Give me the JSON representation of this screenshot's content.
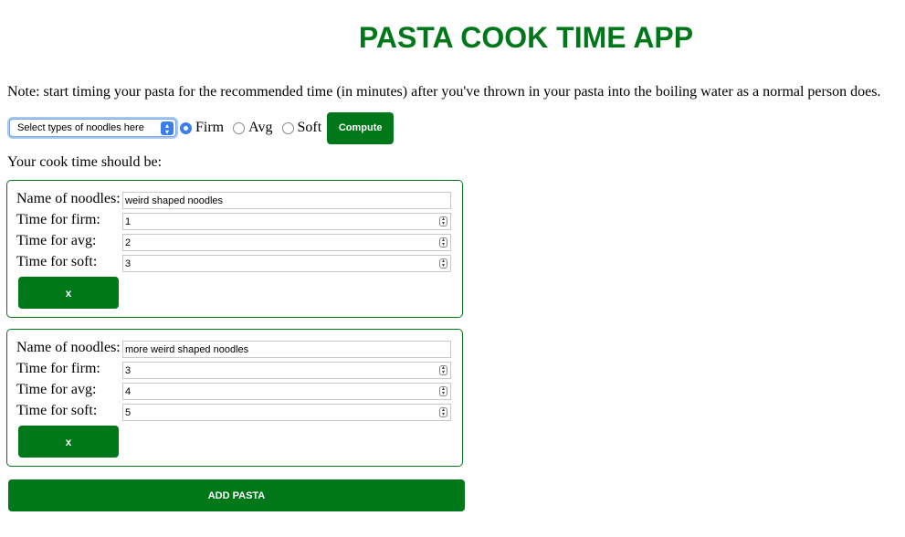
{
  "header": {
    "title": "PASTA COOK TIME APP"
  },
  "note": "Note: start timing your pasta for the recommended time (in minutes) after you've thrown in your pasta into the boiling water as a normal person does.",
  "controls": {
    "select_value": "Select types of noodles here",
    "options": [
      {
        "label": "Firm",
        "selected": true
      },
      {
        "label": "Avg",
        "selected": false
      },
      {
        "label": "Soft",
        "selected": false
      }
    ],
    "compute_label": "Compute"
  },
  "result_label": "Your cook time should be:",
  "labels": {
    "name": "Name of noodles:",
    "firm": "Time for firm:",
    "avg": "Time for avg:",
    "soft": "Time for soft:"
  },
  "pastas": [
    {
      "name": "weird shaped noodles",
      "firm": "1",
      "avg": "2",
      "soft": "3",
      "remove_label": "x"
    },
    {
      "name": "more weird shaped noodles",
      "firm": "3",
      "avg": "4",
      "soft": "5",
      "remove_label": "x"
    }
  ],
  "add_label": "ADD PASTA",
  "colors": {
    "accent": "#00781a",
    "focus": "#3b7ee8"
  }
}
